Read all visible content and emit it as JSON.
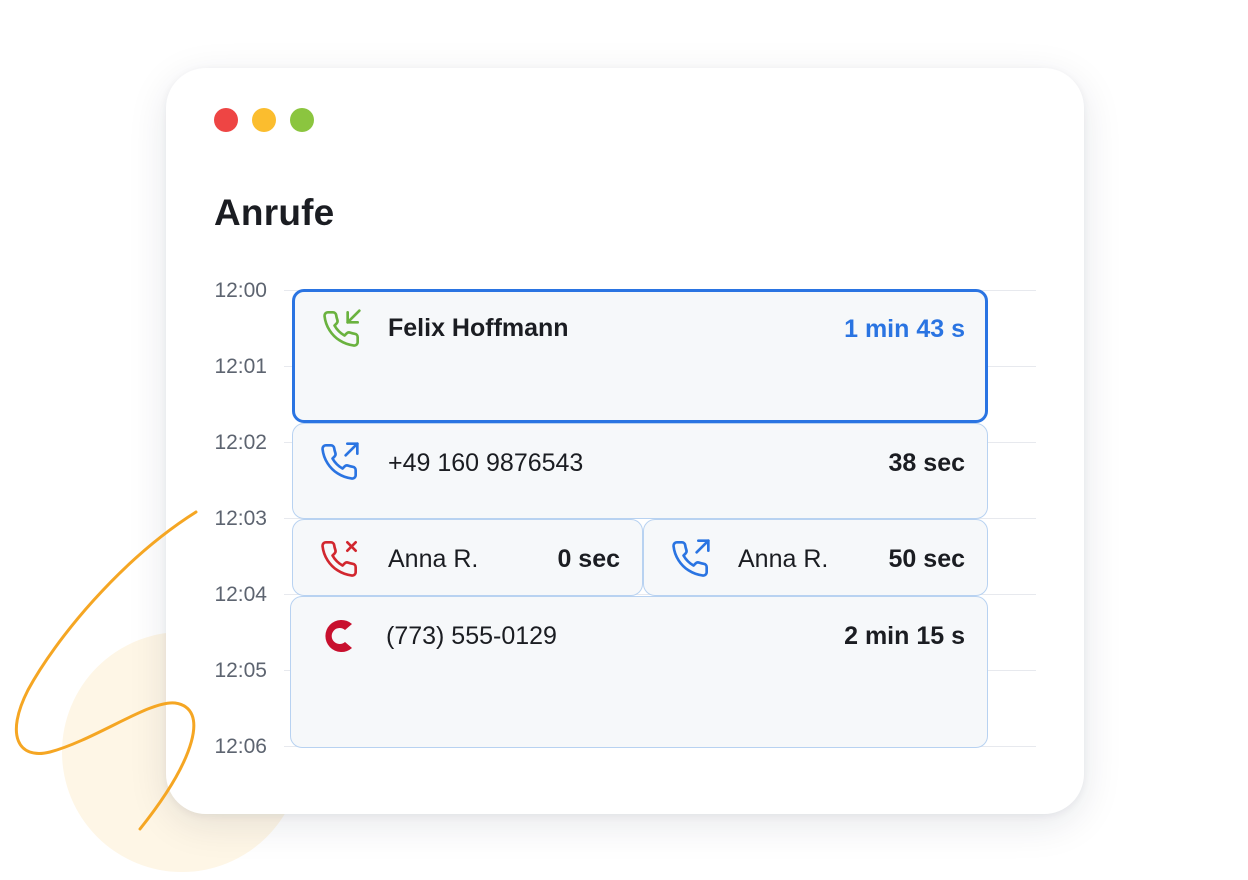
{
  "window": {
    "controls": [
      "close",
      "minimize",
      "maximize"
    ],
    "title": "Anrufe"
  },
  "timeline": {
    "ticks": [
      "12:00",
      "12:01",
      "12:02",
      "12:03",
      "12:04",
      "12:05",
      "12:06"
    ]
  },
  "calls": [
    {
      "icon": "phone-incoming-icon",
      "name": "Felix Hoffmann",
      "duration": "1 min 43 s",
      "selected": true
    },
    {
      "icon": "phone-outgoing-icon",
      "name": "+49 160 9876543",
      "duration": "38 sec"
    },
    {
      "icon": "phone-missed-icon",
      "name": "Anna R.",
      "duration": "0 sec"
    },
    {
      "icon": "phone-outgoing-icon",
      "name": "Anna R.",
      "duration": "50 sec"
    },
    {
      "icon": "app-logo-icon",
      "name": "(773) 555-0129",
      "duration": "2 min 15 s"
    }
  ],
  "colors": {
    "accent": "#2a74e2",
    "incoming": "#6ab23f",
    "outgoing": "#2a74e2",
    "missed": "#d2272f",
    "logo": "#c8102e",
    "decoration": "#f5a623"
  }
}
